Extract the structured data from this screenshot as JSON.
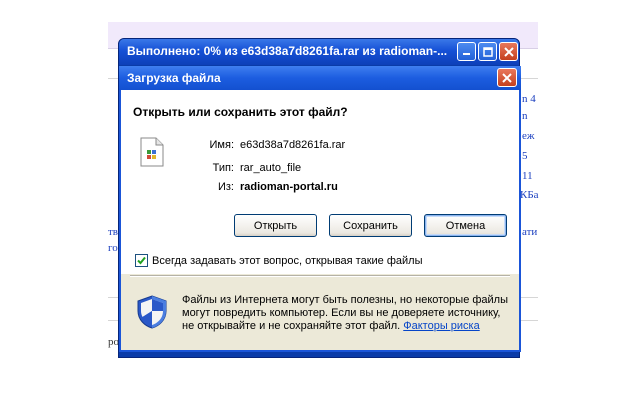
{
  "background_page": {
    "right_fragments": [
      "n 4",
      "n",
      "еж",
      "5",
      "11",
      "КБа",
      "ати"
    ],
    "left_fragments": [
      "тве",
      "го",
      "ро"
    ]
  },
  "download_window": {
    "title": "Выполнено: 0% из e63d38a7d8261fa.rar из radioman-..."
  },
  "dialog": {
    "title": "Загрузка файла",
    "question": "Открыть или сохранить этот файл?",
    "name_label": "Имя:",
    "name_value": "e63d38a7d8261fa.rar",
    "type_label": "Тип:",
    "type_value": "rar_auto_file",
    "from_label": "Из:",
    "from_value": "radioman-portal.ru",
    "open_button": "Открыть",
    "save_button": "Сохранить",
    "cancel_button": "Отмена",
    "always_ask_label": "Всегда задавать этот вопрос, открывая такие файлы",
    "always_ask_checked": true,
    "warning_text": "Файлы из Интернета могут быть полезны, но некоторые файлы могут повредить компьютер. Если вы не доверяете источнику, не открывайте и не сохраняйте этот файл.",
    "risk_link": "Факторы риска"
  },
  "icons": {
    "file": "rar-file-icon",
    "shield": "security-shield-icon",
    "close": "close-icon",
    "minimize": "minimize-icon",
    "maximize": "maximize-icon"
  },
  "colors": {
    "titlebar_blue": "#1c5de0",
    "dialog_bg": "#ece9d8",
    "link": "#0645c8",
    "close_red": "#c5401e"
  }
}
